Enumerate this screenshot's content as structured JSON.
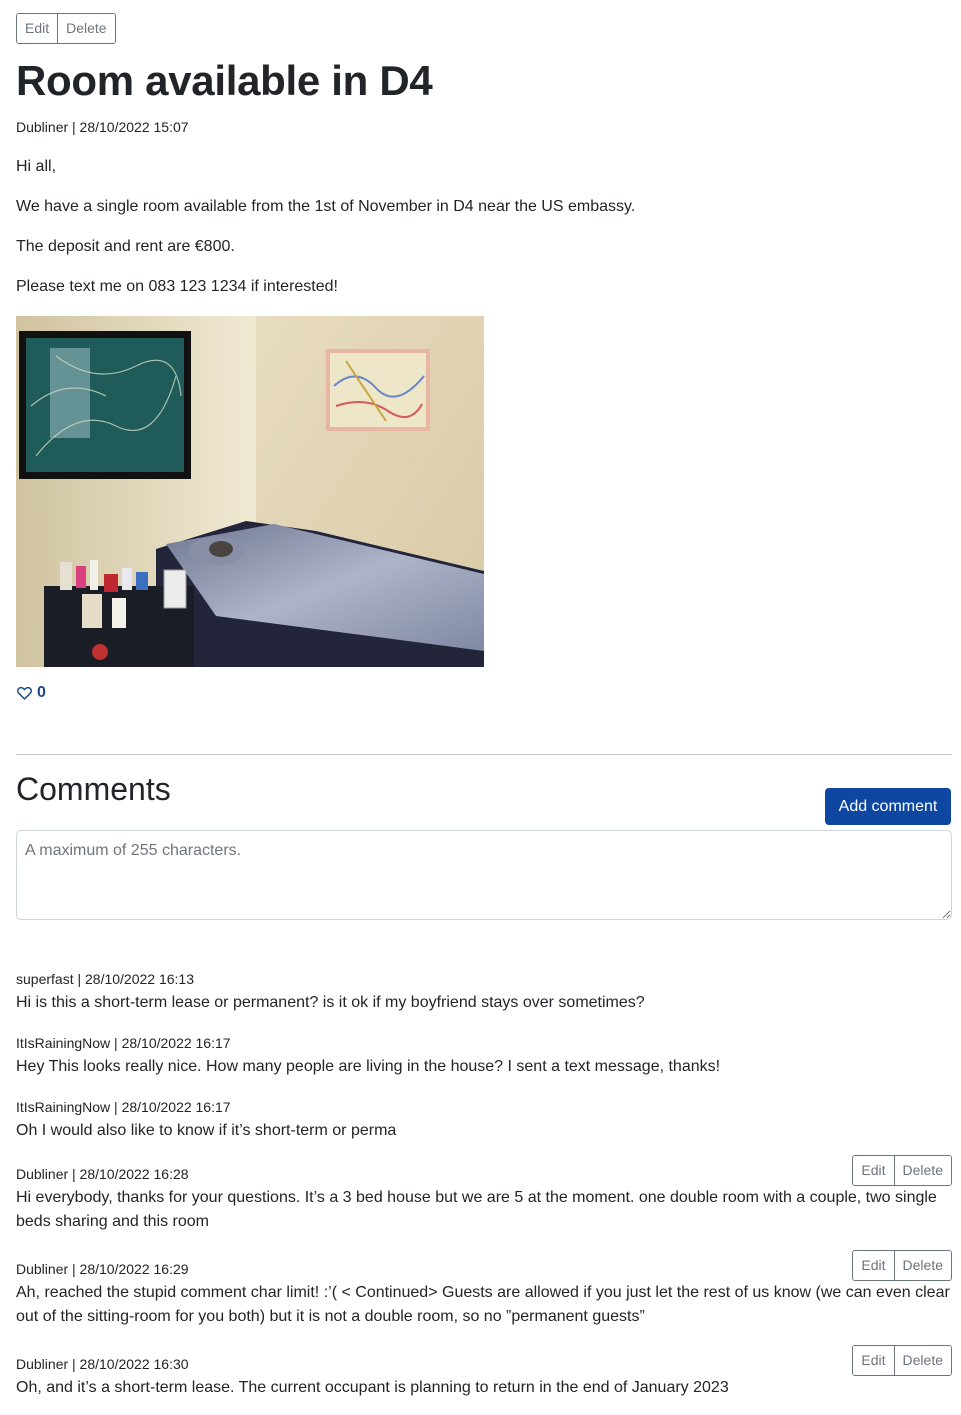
{
  "post": {
    "edit_label": "Edit",
    "delete_label": "Delete",
    "title": "Room available in D4",
    "meta": "Dubliner | 28/10/2022 15:07",
    "paragraphs": [
      "Hi all,",
      "We have a single room available from the 1st of November in D4 near the US embassy.",
      "The deposit and rent are €800.",
      "Please text me on 083 123 1234 if interested!"
    ],
    "likes": "0",
    "like_icon": "heart-outline-icon"
  },
  "comments_section": {
    "title": "Comments",
    "add_label": "Add comment",
    "placeholder": "A maximum of 255 characters."
  },
  "comments": [
    {
      "meta": "superfast | 28/10/2022 16:13",
      "text": "Hi is this a short-term lease or permanent? is it ok if my boyfriend stays over sometimes?",
      "owned": false
    },
    {
      "meta": "ItIsRainingNow | 28/10/2022 16:17",
      "text": "Hey This looks really nice. How many people are living in the house? I sent a text message, thanks!",
      "owned": false
    },
    {
      "meta": "ItIsRainingNow | 28/10/2022 16:17",
      "text": "Oh I would also like to know if it’s short-term or perma",
      "owned": false
    },
    {
      "meta": "Dubliner | 28/10/2022 16:28",
      "text": "Hi everybody, thanks for your questions. It’s a 3 bed house but we are 5 at the moment. one double room with a couple, two single beds sharing and this room",
      "owned": true
    },
    {
      "meta": "Dubliner | 28/10/2022 16:29",
      "text": "Ah, reached the stupid comment char limit! :’( < Continued> Guests are allowed if you just let the rest of us know (we can even clear out of the sitting-room for you both) but it is not a double room, so no ”permanent guests”",
      "owned": true
    },
    {
      "meta": "Dubliner | 28/10/2022 16:30",
      "text": "Oh, and it’s a short-term lease. The current occupant is planning to return in the end of January 2023",
      "owned": true
    }
  ],
  "comment_actions": {
    "edit_label": "Edit",
    "delete_label": "Delete"
  }
}
